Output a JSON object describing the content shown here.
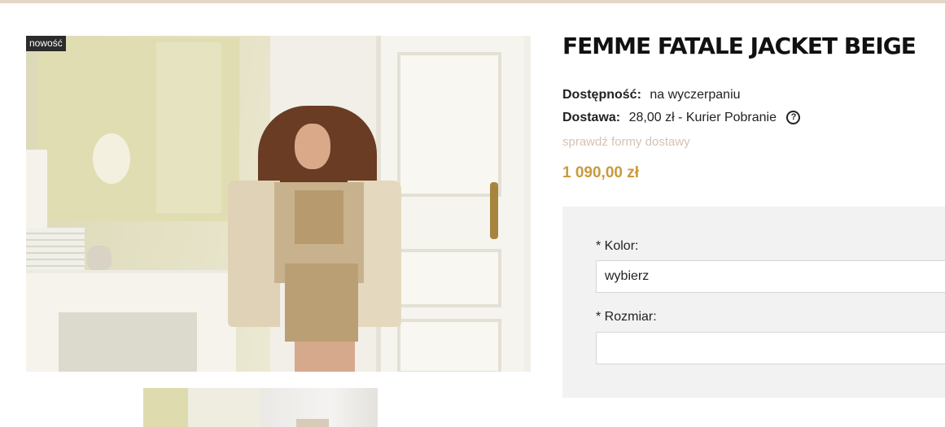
{
  "gallery": {
    "badge": "nowość",
    "main_alt": "Femme Fatale Jacket Beige product photo",
    "thumbnails": [
      "thumbnail-1",
      "thumbnail-2"
    ]
  },
  "product": {
    "title": "FEMME FATALE JACKET BEIGE",
    "availability_label": "Dostępność:",
    "availability_value": "na wyczerpaniu",
    "delivery_label": "Dostawa:",
    "delivery_value": "28,00 zł - Kurier Pobranie",
    "delivery_help": "?",
    "delivery_link": "sprawdź formy dostawy",
    "price": "1 090,00 zł"
  },
  "options": {
    "color_label": "* Kolor:",
    "color_value": "wybierz",
    "size_label": "* Rozmiar:",
    "size_value": ""
  },
  "colors": {
    "price": "#c99a3e",
    "link": "#d6c2b2",
    "options_bg": "#f2f2f2",
    "top_strip": "#e3d6c6"
  }
}
